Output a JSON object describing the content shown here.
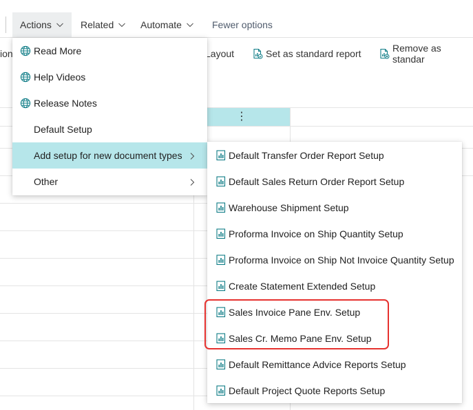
{
  "topbar": {
    "actions_label": "Actions",
    "related_label": "Related",
    "automate_label": "Automate",
    "fewer_label": "Fewer options"
  },
  "toolbar2": {
    "clipped_left": "ion",
    "layout_label": "Layout",
    "set_standard_label": "Set as standard report",
    "remove_standard_label": "Remove as standar"
  },
  "actions_menu": {
    "items": [
      {
        "label": "Read More",
        "icon": "globe-icon"
      },
      {
        "label": "Help Videos",
        "icon": "globe-icon"
      },
      {
        "label": "Release Notes",
        "icon": "globe-icon"
      },
      {
        "label": "Default Setup"
      },
      {
        "label": "Add setup for new document types",
        "submenu": true
      },
      {
        "label": "Other",
        "submenu": true
      }
    ]
  },
  "submenu": {
    "items": [
      {
        "label": "Default Transfer Order Report Setup"
      },
      {
        "label": "Default Sales Return Order Report Setup"
      },
      {
        "label": "Warehouse Shipment Setup"
      },
      {
        "label": "Proforma Invoice on Ship Quantity Setup"
      },
      {
        "label": "Proforma Invoice on Ship Not Invoice Quantity Setup"
      },
      {
        "label": "Create Statement Extended Setup"
      },
      {
        "label": "Sales Invoice Pane Env. Setup"
      },
      {
        "label": "Sales Cr. Memo Pane Env. Setup"
      },
      {
        "label": "Default Remittance Advice Reports Setup"
      },
      {
        "label": "Default Project Quote Reports Setup"
      }
    ]
  },
  "colors": {
    "selection": "#b6e6ea",
    "highlight_border": "#e6312e",
    "icon_teal": "#0e7c86"
  }
}
